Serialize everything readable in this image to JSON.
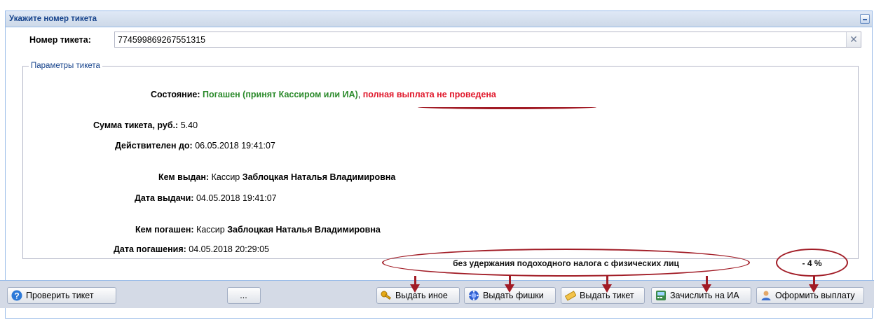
{
  "panel": {
    "title": "Укажите номер тикета"
  },
  "ticket": {
    "label": "Номер тикета:",
    "value": "774599869267551315",
    "clear_icon": "close-icon"
  },
  "params": {
    "legend": "Параметры тикета",
    "state_label": "Состояние:",
    "state_value_green": "Погашен (принят Кассиром или ИА)",
    "state_sep": ",",
    "state_value_red": "полная выплата не проведена",
    "sum_label": "Сумма тикета, руб.:",
    "sum_value": "5.40",
    "valid_label": "Действителен до:",
    "valid_value": "06.05.2018 19:41:07",
    "issued_by_label": "Кем выдан:",
    "issued_by_role": "Кассир",
    "issued_by_name": "Заблоцкая Наталья Владимировна",
    "issue_date_label": "Дата выдачи:",
    "issue_date_value": "04.05.2018 19:41:07",
    "redeemed_by_label": "Кем погашен:",
    "redeemed_by_role": "Кассир",
    "redeemed_by_name": "Заблоцкая Наталья Владимировна",
    "redeem_date_label": "Дата погашения:",
    "redeem_date_value": "04.05.2018 20:29:05"
  },
  "toolbar": {
    "check": "Проверить тикет",
    "more": "...",
    "other": "Выдать иное",
    "chips": "Выдать фишки",
    "ticket": "Выдать тикет",
    "credit": "Зачислить на ИА",
    "payout": "Оформить выплату"
  },
  "annotations": {
    "no_tax": "без удержания подоходного налога с физических лиц",
    "minus_percent": "- 4 %"
  },
  "colors": {
    "header_text": "#15428b",
    "green": "#2b8a2b",
    "red": "#e0182b",
    "annotation": "#a11b25"
  }
}
